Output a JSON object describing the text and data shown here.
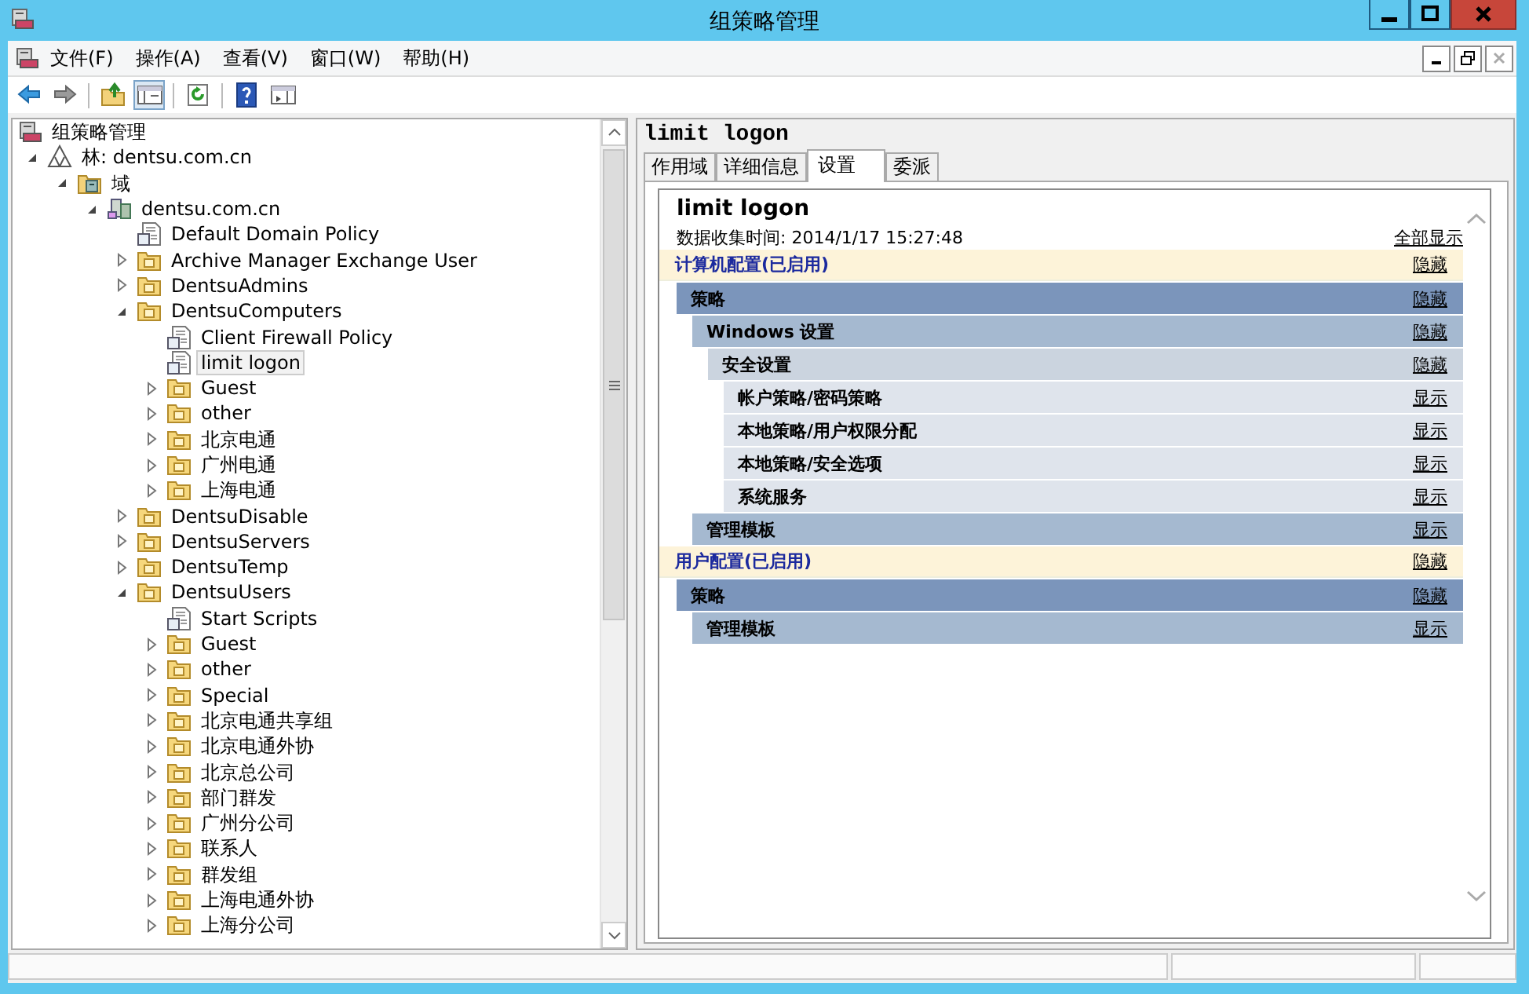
{
  "window": {
    "title": "组策略管理"
  },
  "menu": [
    "文件(F)",
    "操作(A)",
    "查看(V)",
    "窗口(W)",
    "帮助(H)"
  ],
  "toolbar": [
    {
      "kind": "back",
      "pressed": false
    },
    {
      "kind": "forward",
      "pressed": false
    },
    {
      "kind": "up",
      "pressed": false
    },
    {
      "kind": "tree",
      "pressed": true
    },
    {
      "kind": "refresh",
      "pressed": false
    },
    {
      "kind": "help",
      "pressed": false
    },
    {
      "kind": "pane",
      "pressed": false
    }
  ],
  "tree": {
    "label": "组策略管理",
    "kind": "root",
    "selected": false,
    "children": [
      {
        "label": "林: dentsu.com.cn",
        "kind": "forest",
        "expanded": true,
        "selected": false,
        "children": [
          {
            "label": "域",
            "kind": "domains",
            "expanded": true,
            "selected": false,
            "children": [
              {
                "label": "dentsu.com.cn",
                "kind": "domain",
                "expanded": true,
                "selected": false,
                "children": [
                  {
                    "label": "Default Domain Policy",
                    "kind": "gpo",
                    "selected": false
                  },
                  {
                    "label": "Archive Manager Exchange User",
                    "kind": "ou",
                    "expanded": false,
                    "selected": false
                  },
                  {
                    "label": "DentsuAdmins",
                    "kind": "ou",
                    "expanded": false,
                    "selected": false
                  },
                  {
                    "label": "DentsuComputers",
                    "kind": "ou",
                    "expanded": true,
                    "selected": false,
                    "children": [
                      {
                        "label": "Client Firewall Policy",
                        "kind": "gpo",
                        "selected": false
                      },
                      {
                        "label": "limit logon",
                        "kind": "gpo",
                        "selected": true
                      },
                      {
                        "label": "Guest",
                        "kind": "ou",
                        "expanded": false,
                        "selected": false
                      },
                      {
                        "label": "other",
                        "kind": "ou",
                        "expanded": false,
                        "selected": false
                      },
                      {
                        "label": "北京电通",
                        "kind": "ou",
                        "expanded": false,
                        "selected": false
                      },
                      {
                        "label": "广州电通",
                        "kind": "ou",
                        "expanded": false,
                        "selected": false
                      },
                      {
                        "label": "上海电通",
                        "kind": "ou",
                        "expanded": false,
                        "selected": false
                      }
                    ]
                  },
                  {
                    "label": "DentsuDisable",
                    "kind": "ou",
                    "expanded": false,
                    "selected": false
                  },
                  {
                    "label": "DentsuServers",
                    "kind": "ou",
                    "expanded": false,
                    "selected": false
                  },
                  {
                    "label": "DentsuTemp",
                    "kind": "ou",
                    "expanded": false,
                    "selected": false
                  },
                  {
                    "label": "DentsuUsers",
                    "kind": "ou",
                    "expanded": true,
                    "selected": false,
                    "children": [
                      {
                        "label": "Start Scripts",
                        "kind": "gpo",
                        "selected": false
                      },
                      {
                        "label": "Guest",
                        "kind": "ou",
                        "expanded": false,
                        "selected": false
                      },
                      {
                        "label": "other",
                        "kind": "ou",
                        "expanded": false,
                        "selected": false
                      },
                      {
                        "label": "Special",
                        "kind": "ou",
                        "expanded": false,
                        "selected": false
                      },
                      {
                        "label": "北京电通共享组",
                        "kind": "ou",
                        "expanded": false,
                        "selected": false
                      },
                      {
                        "label": "北京电通外协",
                        "kind": "ou",
                        "expanded": false,
                        "selected": false
                      },
                      {
                        "label": "北京总公司",
                        "kind": "ou",
                        "expanded": false,
                        "selected": false
                      },
                      {
                        "label": "部门群发",
                        "kind": "ou",
                        "expanded": false,
                        "selected": false
                      },
                      {
                        "label": "广州分公司",
                        "kind": "ou",
                        "expanded": false,
                        "selected": false
                      },
                      {
                        "label": "联系人",
                        "kind": "ou",
                        "expanded": false,
                        "selected": false
                      },
                      {
                        "label": "群发组",
                        "kind": "ou",
                        "expanded": false,
                        "selected": false
                      },
                      {
                        "label": "上海电通外协",
                        "kind": "ou",
                        "expanded": false,
                        "selected": false
                      },
                      {
                        "label": "上海分公司",
                        "kind": "ou",
                        "expanded": false,
                        "selected": false
                      }
                    ]
                  }
                ]
              }
            ]
          }
        ]
      }
    ]
  },
  "details": {
    "header": "limit logon",
    "tabs": [
      {
        "label": "作用域",
        "selected": false
      },
      {
        "label": "详细信息",
        "selected": false
      },
      {
        "label": "设置",
        "selected": true
      },
      {
        "label": "委派",
        "selected": false
      }
    ],
    "report": {
      "title": "limit logon",
      "collected": "数据收集时间: 2014/1/17 15:27:48",
      "show_all": "全部显示",
      "sections": [
        {
          "kind": "config",
          "title": "计算机配置(已启用)",
          "action": "隐藏",
          "children": [
            {
              "kind": "category",
              "title": "策略",
              "action": "隐藏",
              "children": [
                {
                  "kind": "category",
                  "title": "Windows 设置",
                  "action": "隐藏",
                  "children": [
                    {
                      "kind": "category",
                      "title": "安全设置",
                      "action": "隐藏",
                      "children": [
                        {
                          "kind": "category",
                          "title": "帐户策略/密码策略",
                          "action": "显示"
                        },
                        {
                          "kind": "category",
                          "title": "本地策略/用户权限分配",
                          "action": "显示"
                        },
                        {
                          "kind": "category",
                          "title": "本地策略/安全选项",
                          "action": "显示"
                        },
                        {
                          "kind": "category",
                          "title": "系统服务",
                          "action": "显示"
                        }
                      ]
                    }
                  ]
                },
                {
                  "kind": "category",
                  "title": "管理模板",
                  "action": "显示"
                }
              ]
            }
          ]
        },
        {
          "kind": "config",
          "title": "用户配置(已启用)",
          "action": "隐藏",
          "children": [
            {
              "kind": "category",
              "title": "策略",
              "action": "隐藏",
              "children": [
                {
                  "kind": "category",
                  "title": "管理模板",
                  "action": "显示"
                }
              ]
            }
          ]
        }
      ]
    }
  }
}
